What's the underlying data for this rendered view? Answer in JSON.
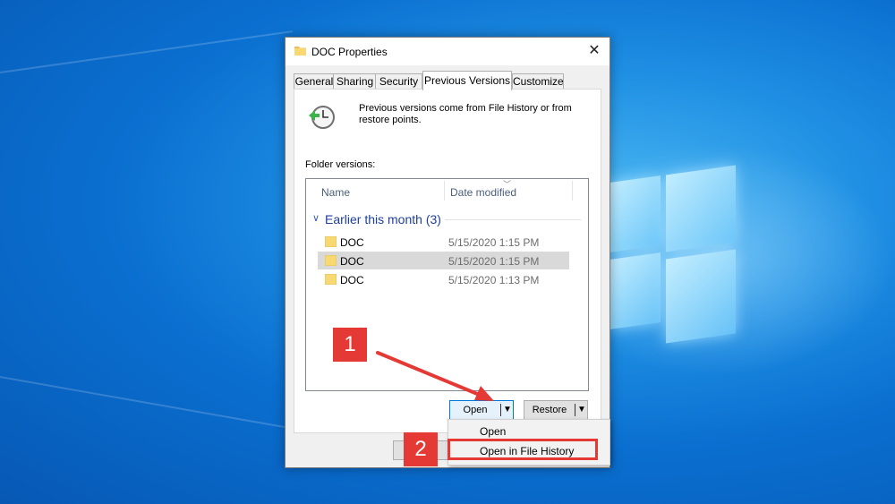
{
  "dialog": {
    "title": "DOC Properties",
    "tabs": [
      {
        "label": "General"
      },
      {
        "label": "Sharing"
      },
      {
        "label": "Security"
      },
      {
        "label": "Previous Versions",
        "active": true
      },
      {
        "label": "Customize"
      }
    ],
    "info_text": "Previous versions come from File History or from restore points.",
    "folder_versions_label": "Folder versions:",
    "columns": {
      "name": "Name",
      "date": "Date modified"
    },
    "group": {
      "label": "Earlier this month (3)"
    },
    "rows": [
      {
        "name": "DOC",
        "date": "5/15/2020 1:15 PM"
      },
      {
        "name": "DOC",
        "date": "5/15/2020 1:15 PM",
        "selected": true
      },
      {
        "name": "DOC",
        "date": "5/15/2020 1:13 PM"
      }
    ],
    "buttons": {
      "open": "Open",
      "restore": "Restore"
    },
    "dropdown_menu": [
      "Open",
      "Open in File History"
    ]
  },
  "annotations": {
    "step1": "1",
    "step2": "2",
    "highlight_color": "#e53935"
  },
  "colors": {
    "desktop": "#0a6fd0",
    "group_text": "#1e3fa0",
    "selected_row": "#d9d9d9"
  }
}
